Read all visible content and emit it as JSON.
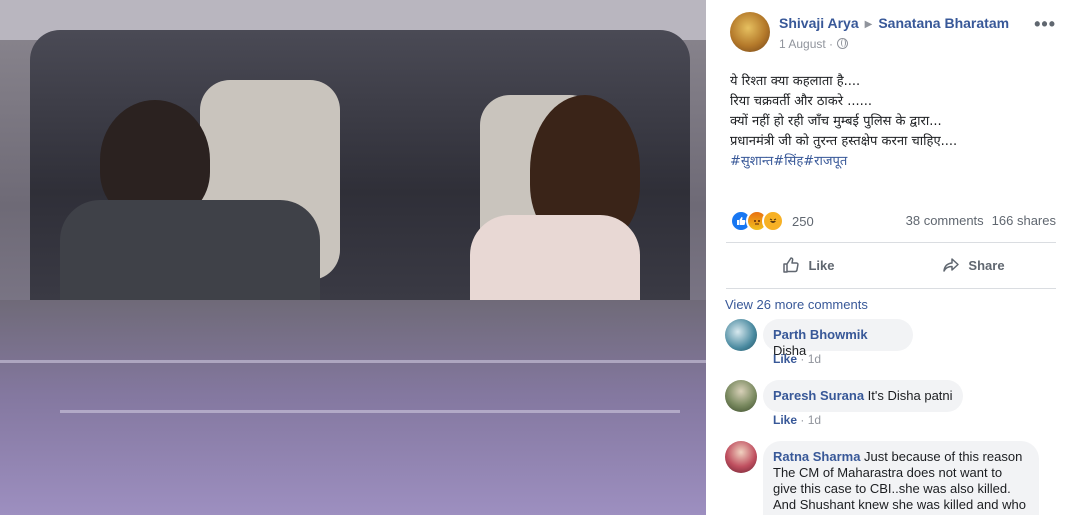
{
  "post": {
    "author": "Shivaji Arya",
    "group": "Sanatana Bharatam",
    "date": "1 August",
    "lines": [
      "ये रिश्ता क्या कहलाता है....",
      "रिया चक्रवर्ती और ठाकरे ......",
      "क्यों नहीं हो रही जाँच मुम्बई पुलिस के द्वारा...",
      "प्रधानमंत्री जी को तुरन्त हस्तक्षेप करना चाहिए...."
    ],
    "hashtags": "#सुशान्त#सिंह#राजपूत",
    "reaction_count": "250",
    "comments_count": "38 comments",
    "shares_count": "166 shares",
    "like_label": "Like",
    "share_label": "Share",
    "view_more": "View 26 more comments"
  },
  "comments": [
    {
      "name": "Parth Bhowmik",
      "text": "Disha",
      "like": "Like",
      "time": "1d"
    },
    {
      "name": "Paresh Surana",
      "text": "It's Disha patni",
      "like": "Like",
      "time": "1d"
    },
    {
      "name": "Ratna Sharma",
      "text": "Just because of this reason The CM of Maharastra does not want to give this case to CBI..she was also killed. And Shushant knew she was killed and who"
    }
  ],
  "colors": {
    "link": "#385898",
    "secondary": "#90949c",
    "bubble": "#f2f3f5"
  },
  "icons": [
    "globe-icon",
    "more-icon",
    "like-icon",
    "share-icon",
    "like-reaction-icon",
    "angry-reaction-icon",
    "haha-reaction-icon"
  ]
}
